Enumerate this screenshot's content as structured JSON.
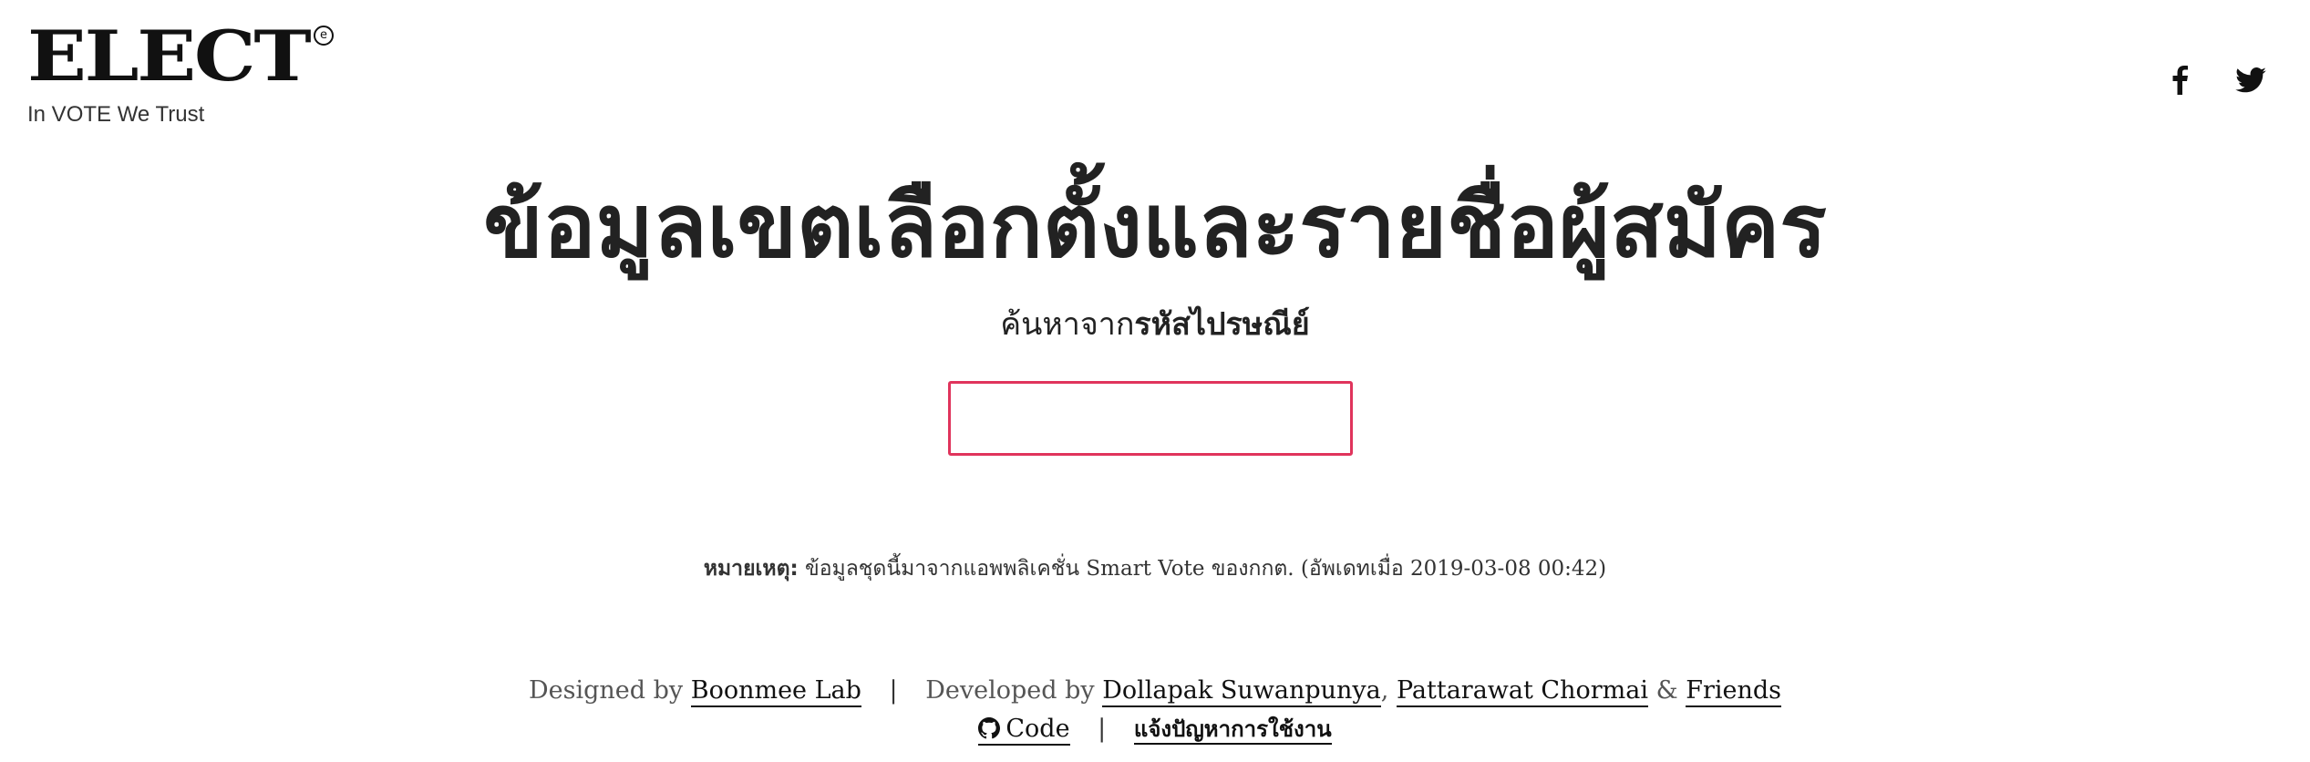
{
  "header": {
    "logo_text": "ELECT",
    "logo_mark": "e",
    "tagline": "In VOTE We Trust",
    "social": [
      {
        "icon": "facebook-icon"
      },
      {
        "icon": "twitter-icon"
      }
    ]
  },
  "main": {
    "title": "ข้อมูลเขตเลือกตั้งและรายชื่อผู้สมัคร",
    "subtitle_prefix": "ค้นหาจาก",
    "subtitle_bold": "รหัสไปรษณีย์",
    "postal_input": {
      "value": "",
      "placeholder": "",
      "border_color": "#e0345c"
    }
  },
  "note": {
    "label": "หมายเหตุ:",
    "text": " ข้อมูลชุดนี้มาจากแอพพลิเคชั่น Smart Vote ของกกต. (อัพเดทเมื่อ 2019-03-08 00:42)"
  },
  "footer": {
    "designed_by_label": "Designed by",
    "designer_link": "Boonmee Lab",
    "separator": "|",
    "developed_by_label": "Developed by",
    "developer_1": "Dollapak Suwanpunya",
    "comma": ",",
    "developer_2": "Pattarawat Chormai",
    "ampersand": "&",
    "friends_link": "Friends",
    "code_link": "Code",
    "report_link": "แจ้งปัญหาการใช้งาน"
  }
}
